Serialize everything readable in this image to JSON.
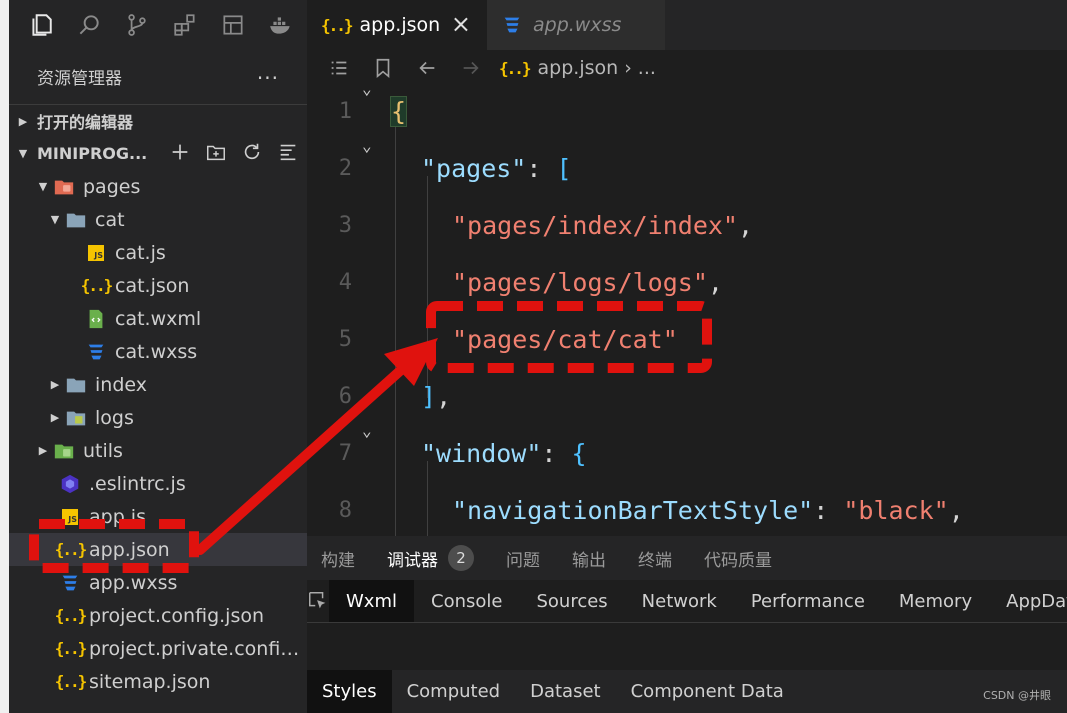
{
  "activity_bar": {
    "icons": [
      "explorer-icon",
      "search-icon",
      "source-control-icon",
      "extensions-icon",
      "layout-icon",
      "docker-icon"
    ]
  },
  "sidebar": {
    "title": "资源管理器",
    "more": "...",
    "open_editors": "打开的编辑器",
    "project": "MINIPROG...",
    "tree": [
      {
        "label": "pages",
        "icon": "folder-pages-icon"
      },
      {
        "label": "cat",
        "icon": "folder-icon"
      },
      {
        "label": "cat.js",
        "icon": "js-file-icon"
      },
      {
        "label": "cat.json",
        "icon": "json-file-icon"
      },
      {
        "label": "cat.wxml",
        "icon": "wxml-file-icon"
      },
      {
        "label": "cat.wxss",
        "icon": "wxss-file-icon"
      },
      {
        "label": "index",
        "icon": "folder-icon"
      },
      {
        "label": "logs",
        "icon": "folder-icon"
      },
      {
        "label": "utils",
        "icon": "folder-icon"
      },
      {
        "label": ".eslintrc.js",
        "icon": "eslint-icon"
      },
      {
        "label": "app.js",
        "icon": "js-file-icon"
      },
      {
        "label": "app.json",
        "icon": "json-file-icon"
      },
      {
        "label": "app.wxss",
        "icon": "wxss-file-icon"
      },
      {
        "label": "project.config.json",
        "icon": "json-file-icon"
      },
      {
        "label": "project.private.config.js...",
        "icon": "json-file-icon"
      },
      {
        "label": "sitemap.json",
        "icon": "json-file-icon"
      }
    ]
  },
  "tabs": {
    "active": "app.json",
    "close": "×",
    "second": "app.wxss",
    "json_glyph": "{..}"
  },
  "breadcrumb": {
    "file": "app.json",
    "sep": "›",
    "rest": "..."
  },
  "editor": {
    "line_numbers": [
      "1",
      "2",
      "3",
      "4",
      "5",
      "6",
      "7",
      "8"
    ],
    "lines": [
      {
        "a": "{"
      },
      {
        "key": "\"pages\"",
        "punc": ": ",
        "bracket": "["
      },
      {
        "str": "\"pages/index/index\"",
        "punc": ","
      },
      {
        "str": "\"pages/logs/logs\"",
        "punc": ","
      },
      {
        "str": "\"pages/cat/cat\""
      },
      {
        "bracket": "]",
        "punc": ","
      },
      {
        "key": "\"window\"",
        "punc": ": ",
        "brace": "{"
      },
      {
        "key": "\"navigationBarTextStyle\"",
        "punc": ": ",
        "str": "\"black\"",
        "punc2": ","
      }
    ]
  },
  "panel": {
    "tabs": [
      "构建",
      "调试器",
      "问题",
      "输出",
      "终端",
      "代码质量"
    ],
    "badge": "2",
    "devtools_tabs": [
      "Wxml",
      "Console",
      "Sources",
      "Network",
      "Performance",
      "Memory",
      "AppData"
    ],
    "style_tabs": [
      "Styles",
      "Computed",
      "Dataset",
      "Component Data"
    ]
  },
  "watermark": "CSDN @井眼",
  "colors": {
    "annotation_red": "#e0120e",
    "json_yellow": "#f5c400",
    "wxss_blue": "#2d7ee8",
    "folder_gray": "#8aa4b8"
  }
}
